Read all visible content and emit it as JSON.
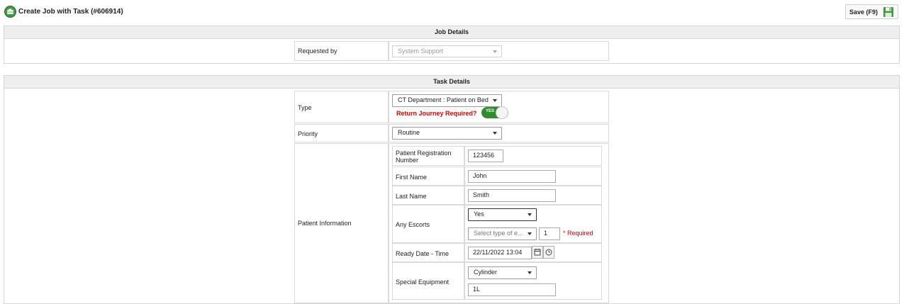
{
  "header": {
    "title": "Create Job with Task (#606914)",
    "save_label": "Save (F9)",
    "logo_icon": "job-task-logo-icon",
    "save_icon": "floppy-disk-icon"
  },
  "job_details": {
    "heading": "Job Details",
    "requested_by_label": "Requested by",
    "requested_by_value": "System Support"
  },
  "task_details": {
    "heading": "Task Details",
    "type_label": "Type",
    "type_value": "CT Department : Patient on Bed",
    "return_journey_label": "Return Journey Required?",
    "return_journey_toggle": "YES",
    "priority_label": "Priority",
    "priority_value": "Routine",
    "patient_info_label": "Patient Information",
    "patient": {
      "registration_label_line1": "Patient Registration",
      "registration_label_line2": "Number",
      "registration_value": "123456",
      "first_name_label": "First Name",
      "first_name_value": "John",
      "last_name_label": "Last Name",
      "last_name_value": "Smith",
      "escorts_label": "Any Escorts",
      "escorts_value": "Yes",
      "escort_type_placeholder": "Select type of e...",
      "escort_count": "1",
      "required_text": "* Required",
      "ready_label": "Ready Date - Time",
      "ready_value": "22/11/2022 13:04",
      "equipment_label": "Special Equipment",
      "equipment_value": "Cylinder",
      "equipment_amount": "1L"
    }
  },
  "colors": {
    "accent_green": "#2e8b2e",
    "required_red": "#e00000",
    "header_bg": "#eeeeee"
  }
}
